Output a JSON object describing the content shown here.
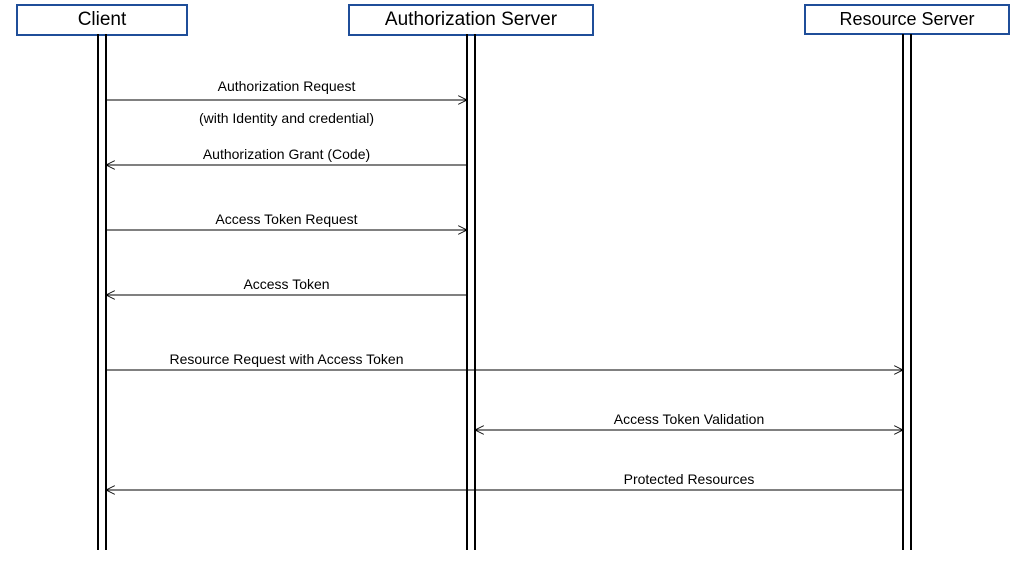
{
  "participants": {
    "client": "Client",
    "authServer": "Authorization Server",
    "resourceServer": "Resource Server"
  },
  "messages": {
    "m1_line1": "Authorization Request",
    "m1_line2": "(with Identity and credential)",
    "m2": "Authorization Grant (Code)",
    "m3": "Access Token Request",
    "m4": "Access Token",
    "m5": "Resource Request with Access Token",
    "m6": "Access Token Validation",
    "m7": "Protected Resources"
  },
  "chart_data": {
    "type": "sequence-diagram",
    "participants": [
      "Client",
      "Authorization Server",
      "Resource Server"
    ],
    "messages": [
      {
        "from": "Client",
        "to": "Authorization Server",
        "label": "Authorization Request (with Identity and credential)",
        "direction": "right"
      },
      {
        "from": "Authorization Server",
        "to": "Client",
        "label": "Authorization Grant (Code)",
        "direction": "left"
      },
      {
        "from": "Client",
        "to": "Authorization Server",
        "label": "Access Token Request",
        "direction": "right"
      },
      {
        "from": "Authorization Server",
        "to": "Client",
        "label": "Access Token",
        "direction": "left"
      },
      {
        "from": "Client",
        "to": "Resource Server",
        "label": "Resource Request with Access Token",
        "direction": "right"
      },
      {
        "from": "Authorization Server",
        "to": "Resource Server",
        "label": "Access Token Validation",
        "direction": "both"
      },
      {
        "from": "Resource Server",
        "to": "Client",
        "label": "Protected Resources",
        "direction": "left"
      }
    ]
  }
}
